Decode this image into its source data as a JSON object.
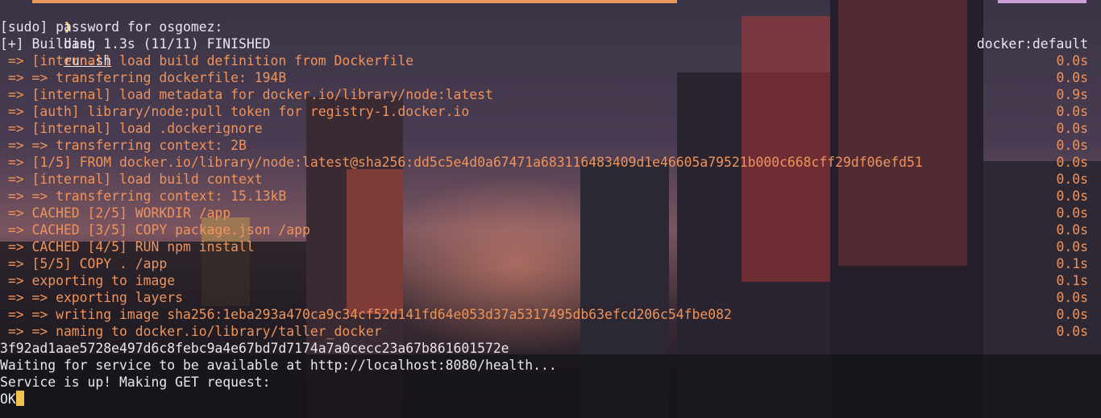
{
  "prompt": {
    "symbol": "❱",
    "command": "bash",
    "argument": "run.sh"
  },
  "lines": [
    {
      "text": "[sudo] password for osgomez:",
      "style": "white"
    },
    {
      "text": "[+] Building 1.3s (11/11) FINISHED",
      "right": "docker:default",
      "style": "white"
    },
    {
      "text": " => [internal] load build definition from Dockerfile",
      "right": "0.0s",
      "style": "step"
    },
    {
      "text": " => => transferring dockerfile: 194B",
      "right": "0.0s",
      "style": "step"
    },
    {
      "text": " => [internal] load metadata for docker.io/library/node:latest",
      "right": "0.9s",
      "style": "step"
    },
    {
      "text": " => [auth] library/node:pull token for registry-1.docker.io",
      "right": "0.0s",
      "style": "step"
    },
    {
      "text": " => [internal] load .dockerignore",
      "right": "0.0s",
      "style": "step"
    },
    {
      "text": " => => transferring context: 2B",
      "right": "0.0s",
      "style": "step"
    },
    {
      "text": " => [1/5] FROM docker.io/library/node:latest@sha256:dd5c5e4d0a67471a683116483409d1e46605a79521b000c668cff29df06efd51",
      "right": "0.0s",
      "style": "step"
    },
    {
      "text": " => [internal] load build context",
      "right": "0.0s",
      "style": "step"
    },
    {
      "text": " => => transferring context: 15.13kB",
      "right": "0.0s",
      "style": "step"
    },
    {
      "text": " => CACHED [2/5] WORKDIR /app",
      "right": "0.0s",
      "style": "step"
    },
    {
      "text": " => CACHED [3/5] COPY package.json /app",
      "right": "0.0s",
      "style": "step"
    },
    {
      "text": " => CACHED [4/5] RUN npm install",
      "right": "0.0s",
      "style": "step"
    },
    {
      "text": " => [5/5] COPY . /app",
      "right": "0.1s",
      "style": "step"
    },
    {
      "text": " => exporting to image",
      "right": "0.1s",
      "style": "step"
    },
    {
      "text": " => => exporting layers",
      "right": "0.0s",
      "style": "step"
    },
    {
      "text": " => => writing image sha256:1eba293a470ca9c34cf52d141fd64e053d37a5317495db63efcd206c54fbe082",
      "right": "0.0s",
      "style": "step"
    },
    {
      "text": " => => naming to docker.io/library/taller_docker",
      "right": "0.0s",
      "style": "step"
    },
    {
      "text": "3f92ad1aae5728e497d6c8febc9a4e67bd7d7174a7a0cecc23a67b861601572e",
      "style": "white"
    },
    {
      "text": "Waiting for service to be available at http://localhost:8080/health...",
      "style": "white"
    },
    {
      "text": "Service is up! Making GET request:",
      "style": "white"
    }
  ],
  "last_line": {
    "text": "OK"
  },
  "colors": {
    "step": "#f0935a",
    "prompt": "#f0cf5a",
    "cursor": "#f2c14e",
    "text": "#e8e6ee"
  }
}
